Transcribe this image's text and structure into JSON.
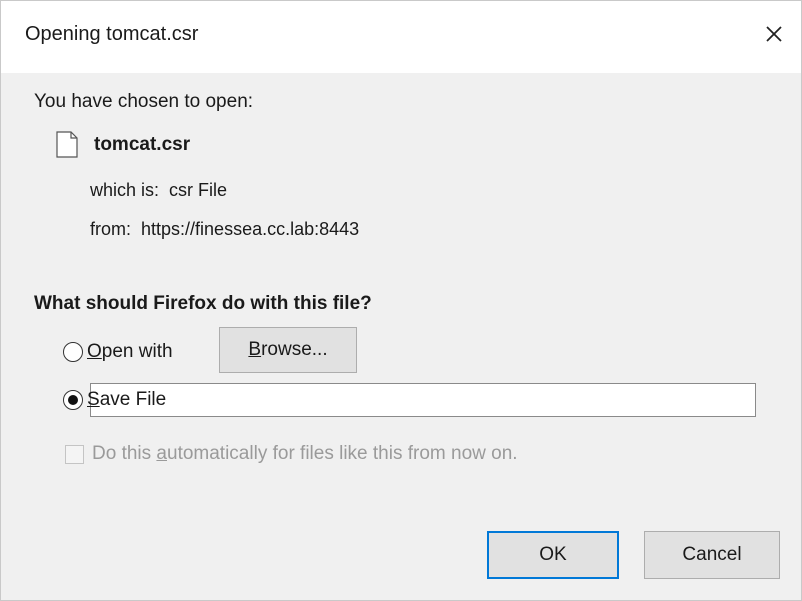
{
  "window": {
    "title": "Opening tomcat.csr",
    "close_glyph": "✕"
  },
  "intro": "You have chosen to open:",
  "file": {
    "name": "tomcat.csr",
    "icon": "file-icon",
    "which_label": "which is:",
    "which_value": "csr File",
    "from_label": "from:",
    "from_value": "https://finessea.cc.lab:8443"
  },
  "question": "What should Firefox do with this file?",
  "options": {
    "open_with": {
      "label_mnemonic": "O",
      "label_rest": "pen with",
      "selected": false
    },
    "browse_button": {
      "label_mnemonic": "B",
      "label_rest": "rowse..."
    },
    "save_file": {
      "label_mnemonic": "S",
      "label_rest": "ave File",
      "selected": true
    }
  },
  "auto_checkbox": {
    "label_pre": "Do this ",
    "label_mnemonic": "a",
    "label_rest": "utomatically for files like this from now on.",
    "checked": false,
    "enabled": false
  },
  "buttons": {
    "ok": "OK",
    "cancel": "Cancel"
  },
  "colors": {
    "focus_border": "#0078d7",
    "disabled_text": "#9a9a9a",
    "dialog_bg": "#f0f0f0"
  }
}
